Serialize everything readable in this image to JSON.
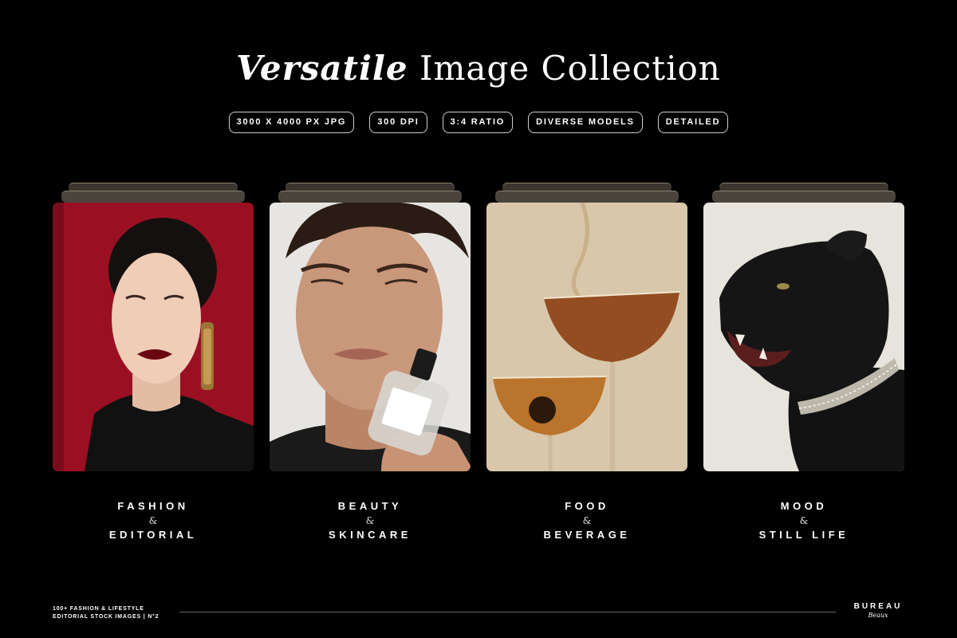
{
  "title": {
    "emphasis": "Versatile",
    "rest": "Image Collection"
  },
  "badges": [
    "3000 X 4000 PX JPG",
    "300 DPI",
    "3:4 RATIO",
    "DIVERSE MODELS",
    "DETAILED"
  ],
  "categories": [
    {
      "line1": "FASHION",
      "amp": "&",
      "line2": "EDITORIAL"
    },
    {
      "line1": "BEAUTY",
      "amp": "&",
      "line2": "SKINCARE"
    },
    {
      "line1": "FOOD",
      "amp": "&",
      "line2": "BEVERAGE"
    },
    {
      "line1": "MOOD",
      "amp": "&",
      "line2": "STILL LIFE"
    }
  ],
  "footer": {
    "line1": "100+ FASHION & LIFESTYLE",
    "line2": "EDITORIAL STOCK IMAGES | N°2",
    "brand": "BUREAU",
    "brand_sub": "Beaux"
  },
  "colors": {
    "background": "#000000",
    "text": "#ffffff",
    "fashion_bg": "#9a1022",
    "food_bg": "#d8c7aa"
  }
}
